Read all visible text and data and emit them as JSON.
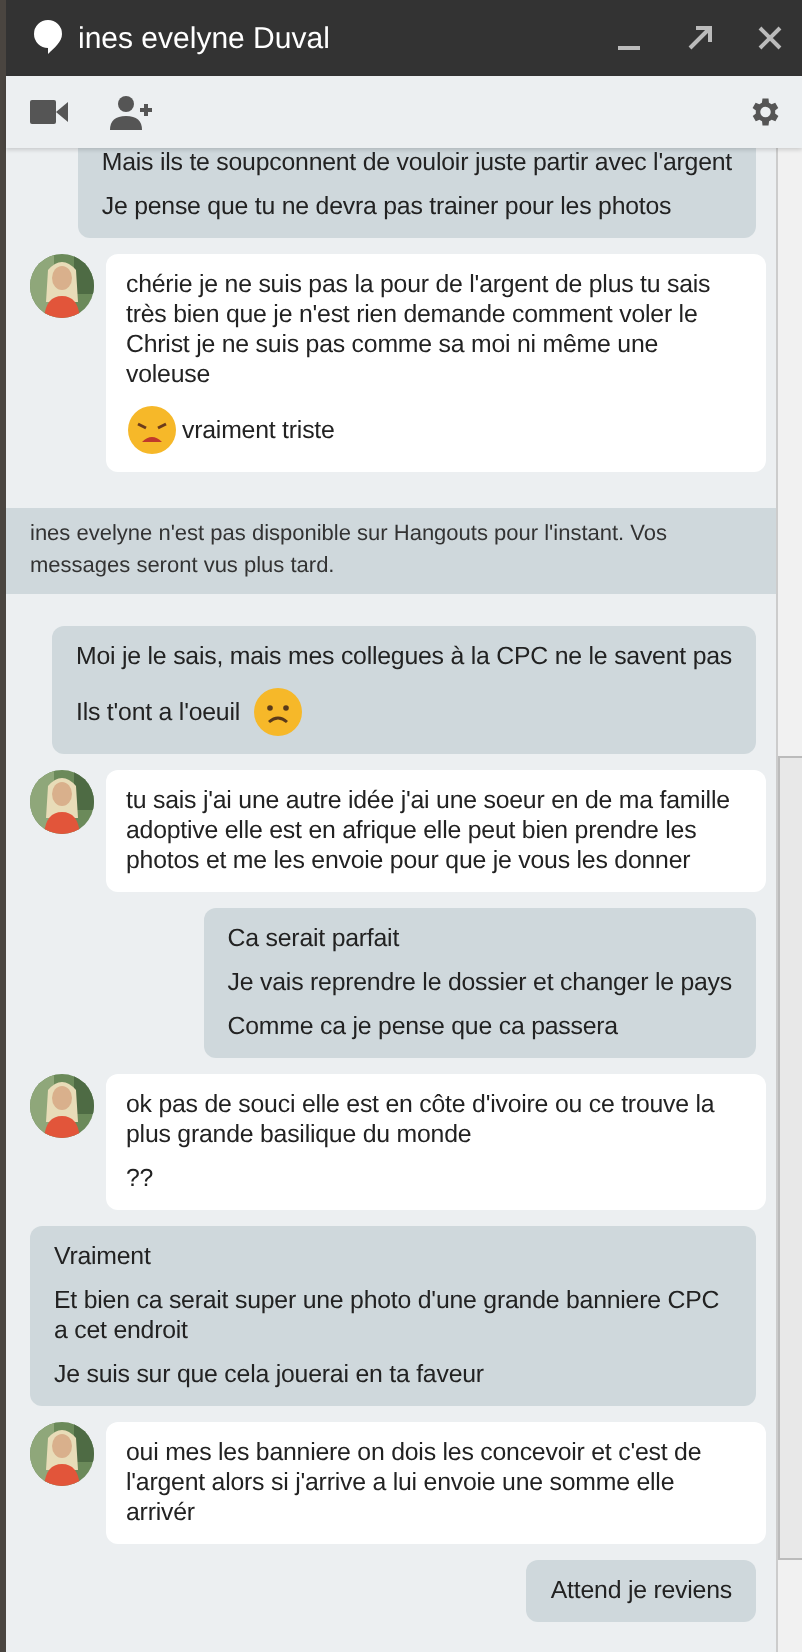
{
  "window": {
    "title": "ines evelyne Duval"
  },
  "messages": [
    {
      "kind": "sent",
      "lines": [
        {
          "text": "Mais ils te soupconnent de vouloir juste partir avec l'argent"
        },
        {
          "text": "Je pense que tu ne devra pas trainer pour les photos"
        }
      ]
    },
    {
      "kind": "received",
      "lines": [
        {
          "text": "chérie je ne suis pas la pour de l'argent de plus tu sais très bien que je n'est rien demande comment voler le Christ je ne suis pas comme sa moi ni même une voleuse"
        },
        {
          "parts": [
            {
              "kind": "weary-emoji"
            },
            {
              "kind": "text",
              "text": "vraiment triste"
            }
          ]
        }
      ]
    },
    {
      "kind": "notice",
      "lines": [
        {
          "text": "ines evelyne n'est pas disponible sur Hangouts pour l'instant. Vos messages seront vus plus tard."
        }
      ]
    },
    {
      "kind": "sent",
      "lines": [
        {
          "text": "Moi je le sais, mais mes collegues à la CPC ne le savent pas"
        },
        {
          "parts": [
            {
              "kind": "text",
              "text": "Ils t'ont a l'oeuil"
            },
            {
              "kind": "frown-emoji"
            }
          ]
        }
      ]
    },
    {
      "kind": "received",
      "lines": [
        {
          "text": "tu sais j'ai une autre idée j'ai une soeur en de ma famille adoptive elle est en afrique elle peut bien prendre les photos et me les envoie pour que je vous les donner"
        }
      ]
    },
    {
      "kind": "sent",
      "lines": [
        {
          "text": "Ca serait parfait"
        },
        {
          "text": "Je vais reprendre le dossier et changer le pays"
        },
        {
          "text": "Comme ca je pense que ca passera"
        }
      ]
    },
    {
      "kind": "received",
      "lines": [
        {
          "text": "ok pas de souci elle est en côte d'ivoire ou ce trouve la plus grande basilique du monde"
        },
        {
          "text": "??"
        }
      ]
    },
    {
      "kind": "sent",
      "lines": [
        {
          "text": "Vraiment"
        },
        {
          "text": "Et bien ca serait super une photo d'une grande banniere CPC a cet endroit"
        },
        {
          "text": "Je suis sur que cela jouerai en ta faveur"
        }
      ]
    },
    {
      "kind": "received",
      "lines": [
        {
          "text": "oui mes les banniere on dois les concevoir et c'est de l'argent alors si j'arrive a lui envoie une somme elle arrivér"
        }
      ]
    },
    {
      "kind": "sent",
      "lines": [
        {
          "text": "Attend je reviens"
        }
      ]
    }
  ]
}
